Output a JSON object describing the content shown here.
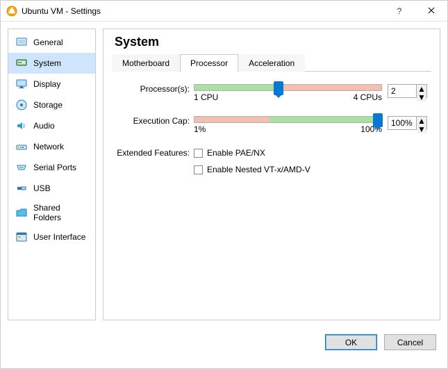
{
  "window": {
    "title": "Ubuntu VM - Settings"
  },
  "sidebar": {
    "items": [
      {
        "label": "General"
      },
      {
        "label": "System"
      },
      {
        "label": "Display"
      },
      {
        "label": "Storage"
      },
      {
        "label": "Audio"
      },
      {
        "label": "Network"
      },
      {
        "label": "Serial Ports"
      },
      {
        "label": "USB"
      },
      {
        "label": "Shared Folders"
      },
      {
        "label": "User Interface"
      }
    ],
    "selected_index": 1
  },
  "panel": {
    "title": "System",
    "tabs": [
      {
        "label": "Motherboard"
      },
      {
        "label": "Processor"
      },
      {
        "label": "Acceleration"
      }
    ],
    "active_tab_index": 1
  },
  "processor": {
    "label": "Processor(s):",
    "min_label": "1 CPU",
    "max_label": "4 CPUs",
    "value": "2",
    "slider_green_start_pct": 0,
    "slider_green_end_pct": 45,
    "slider_red_start_pct": 45,
    "slider_red_end_pct": 100,
    "knob_pct": 45
  },
  "execcap": {
    "label": "Execution Cap:",
    "min_label": "1%",
    "max_label": "100%",
    "value": "100%",
    "slider_red_start_pct": 0,
    "slider_red_end_pct": 40,
    "slider_green_start_pct": 40,
    "slider_green_end_pct": 100,
    "knob_pct": 100
  },
  "features": {
    "label": "Extended Features:",
    "pae": {
      "label": "Enable PAE/NX",
      "checked": false
    },
    "nested": {
      "label": "Enable Nested VT-x/AMD-V",
      "checked": false
    }
  },
  "footer": {
    "ok": "OK",
    "cancel": "Cancel"
  }
}
